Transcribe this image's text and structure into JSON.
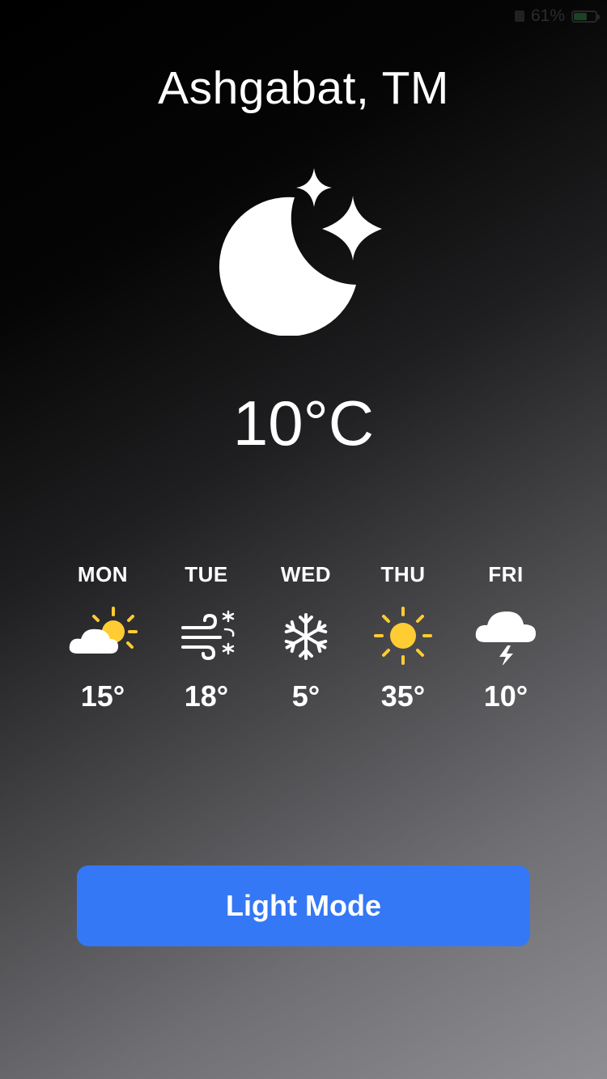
{
  "status_bar": {
    "battery_text": "61%",
    "battery_level": 0.61,
    "battery_color": "#4cd964"
  },
  "location": {
    "city": "Ashgabat, TM"
  },
  "current": {
    "condition_icon": "moon-stars-icon",
    "temperature": "10°C"
  },
  "forecast": [
    {
      "day": "MON",
      "icon": "partly-sunny-icon",
      "temp": "15°"
    },
    {
      "day": "TUE",
      "icon": "windy-snow-icon",
      "temp": "18°"
    },
    {
      "day": "WED",
      "icon": "snowflake-icon",
      "temp": "5°"
    },
    {
      "day": "THU",
      "icon": "sun-icon",
      "temp": "35°"
    },
    {
      "day": "FRI",
      "icon": "thunderstorm-icon",
      "temp": "10°"
    }
  ],
  "mode_toggle": {
    "label": "Light Mode"
  },
  "colors": {
    "accent": "#3478f6",
    "sun": "#ffcc33",
    "text": "#ffffff"
  }
}
